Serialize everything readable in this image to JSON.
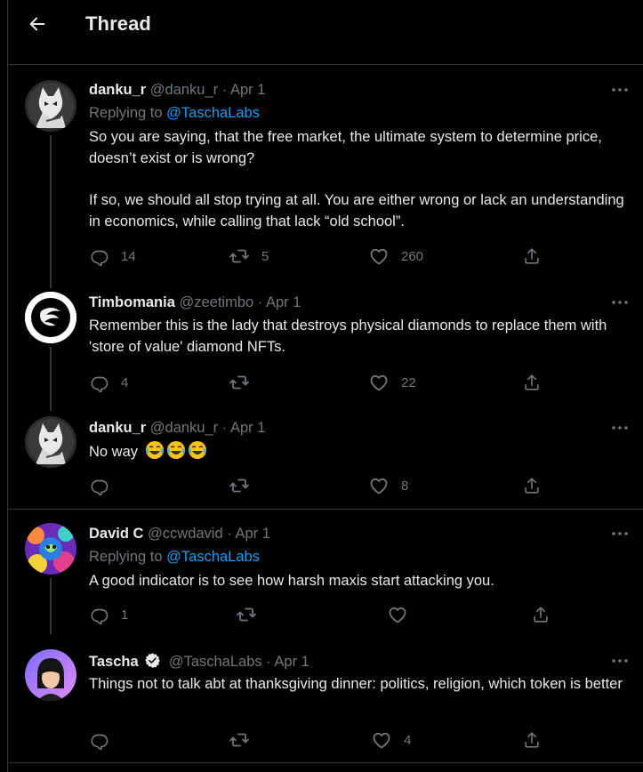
{
  "header": {
    "title": "Thread"
  },
  "tweets": [
    {
      "name": "danku_r",
      "handle": "@danku_r",
      "sep": "·",
      "date": "Apr 1",
      "replying_label": "Replying to",
      "replying_to": "@TaschaLabs",
      "body1": "So you are saying, that the free market, the ultimate system to determine price, doesn’t exist or is wrong?",
      "body2": "If so, we should all stop trying at all. You are either wrong or lack an understanding in economics, while calling that lack “old school”.",
      "replies": "14",
      "retweets": "5",
      "likes": "260"
    },
    {
      "name": "Timbomania",
      "handle": "@zeetimbo",
      "sep": "·",
      "date": "Apr 1",
      "body1": "Remember this is the lady that destroys physical diamonds to replace them with 'store of value' diamond NFTs.",
      "replies": "4",
      "retweets": "",
      "likes": "22"
    },
    {
      "name": "danku_r",
      "handle": "@danku_r",
      "sep": "·",
      "date": "Apr 1",
      "body1": "No way",
      "emoji": "😂😂😂",
      "replies": "",
      "retweets": "",
      "likes": "8"
    },
    {
      "name": "David C",
      "handle": "@ccwdavid",
      "sep": "·",
      "date": "Apr 1",
      "replying_label": "Replying to",
      "replying_to": "@TaschaLabs",
      "body1": "A good indicator is to see how harsh maxis start attacking you.",
      "replies": "1",
      "retweets": "",
      "likes": ""
    },
    {
      "name": "Tascha",
      "handle": "@TaschaLabs",
      "sep": "·",
      "date": "Apr 1",
      "body1": "Things not to talk abt at thanksgiving dinner: politics, religion, which token is better",
      "replies": "",
      "retweets": "",
      "likes": "4"
    }
  ],
  "icons": {
    "back": "arrow-left-icon",
    "more": "more-horizontal-icon",
    "reply": "reply-icon",
    "retweet": "retweet-icon",
    "like": "heart-icon",
    "share": "share-icon",
    "verified": "verified-badge-icon"
  },
  "colors": {
    "background": "#000000",
    "text": "#e7e9ea",
    "muted": "#71767b",
    "link": "#1d9bf0",
    "border": "#2f3336"
  }
}
